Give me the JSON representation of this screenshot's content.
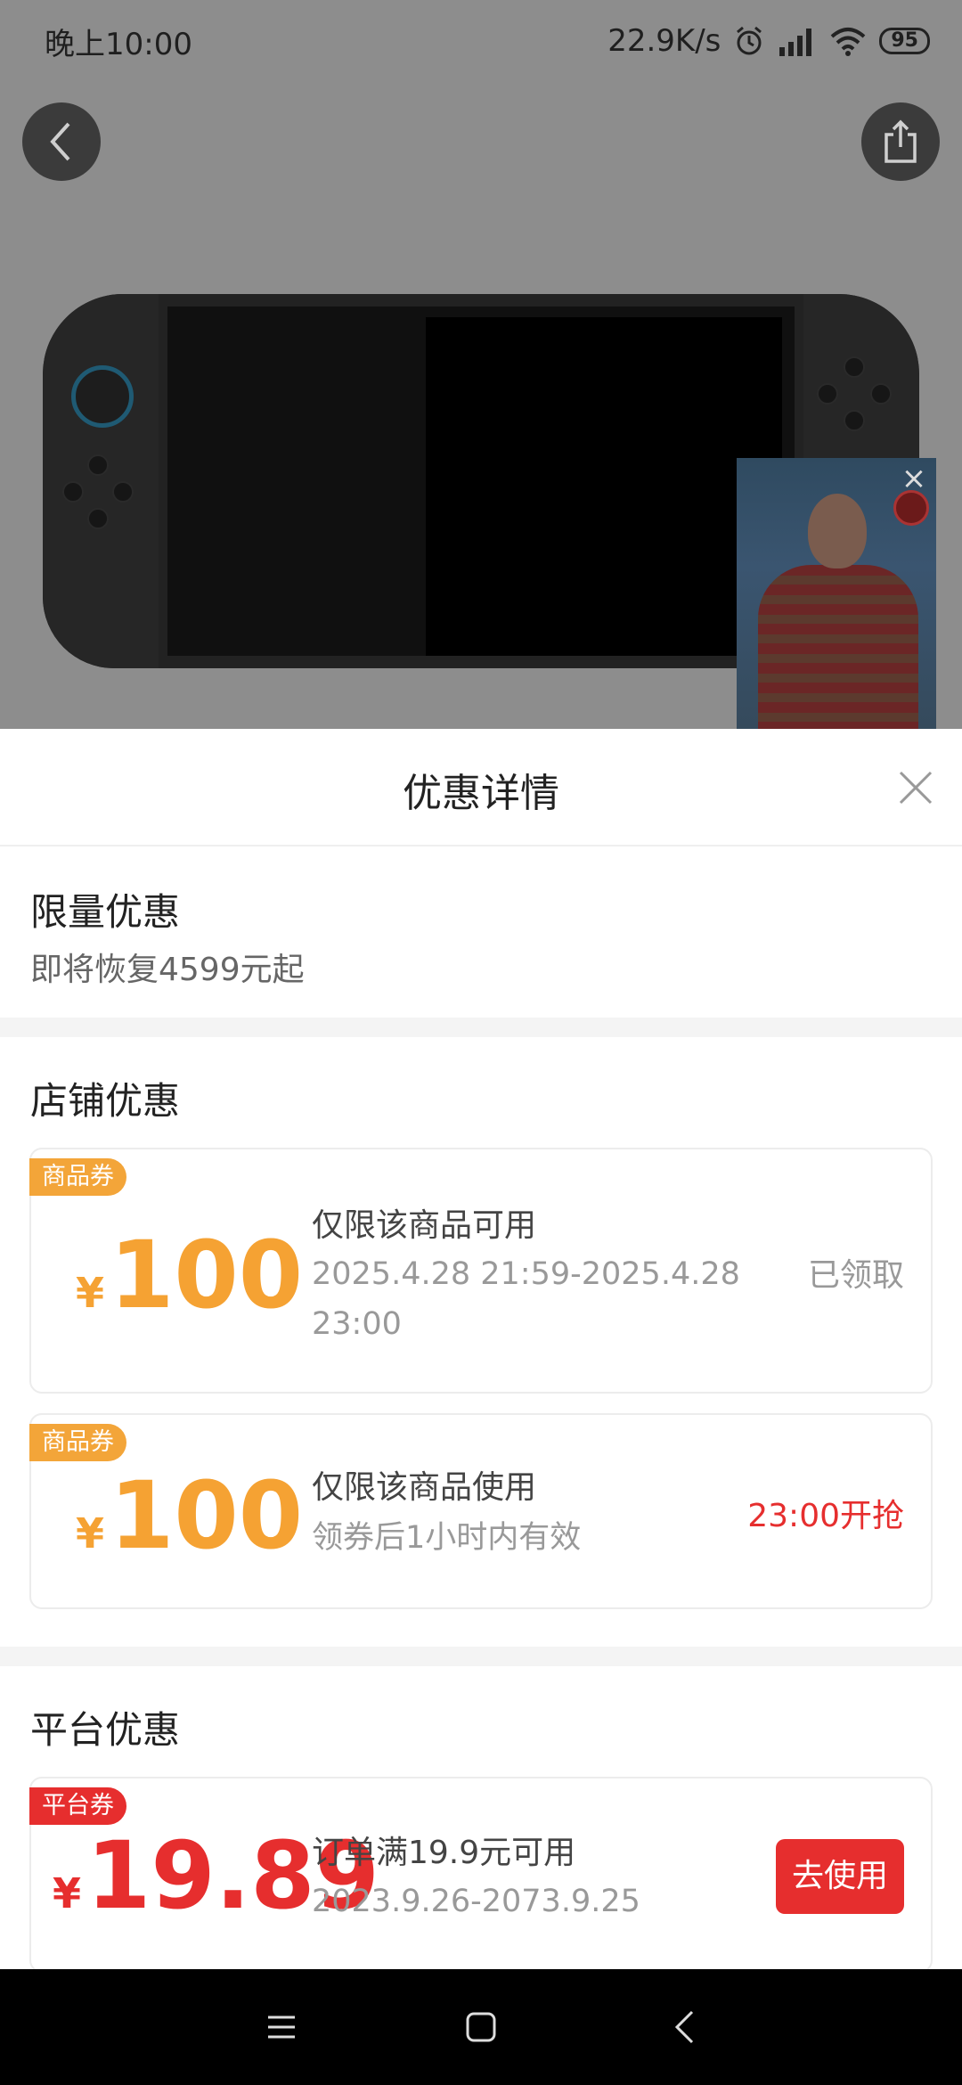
{
  "status_bar": {
    "time": "晚上10:00",
    "net_speed": "22.9K/s",
    "battery": "95",
    "icons": [
      "alarm-icon",
      "signal-icon",
      "wifi-icon",
      "battery-icon"
    ]
  },
  "top_bar": {
    "back_icon": "chevron-left-icon",
    "share_icon": "share-icon"
  },
  "sheet": {
    "title": "优惠详情",
    "close_icon": "close-icon",
    "limited": {
      "title": "限量优惠",
      "subtitle": "即将恢复4599元起"
    },
    "store": {
      "title": "店铺优惠",
      "coupons": [
        {
          "tag": "商品券",
          "currency": "¥",
          "amount": "100",
          "main": "仅限该商品可用",
          "sub_line1": "2025.4.28 21:59-2025.4.28",
          "sub_line2": "23:00",
          "action": "已领取"
        },
        {
          "tag": "商品券",
          "currency": "¥",
          "amount": "100",
          "main": "仅限该商品使用",
          "sub_line1": "领券后1小时内有效",
          "action": "23:00开抢"
        }
      ]
    },
    "platform": {
      "title": "平台优惠",
      "coupons": [
        {
          "tag": "平台券",
          "currency": "¥",
          "amount": "19.89",
          "main": "订单满19.9元可用",
          "sub_line1": "2023.9.26-2073.9.25",
          "action": "去使用"
        }
      ]
    }
  },
  "nav_bar": {
    "menu_icon": "menu-icon",
    "home_icon": "home-square-icon",
    "back_icon": "back-triangle-icon"
  },
  "colors": {
    "accent_red": "#e62e2e",
    "coupon_orange": "#f5a233",
    "dim_overlay": "#8d8d8d"
  }
}
